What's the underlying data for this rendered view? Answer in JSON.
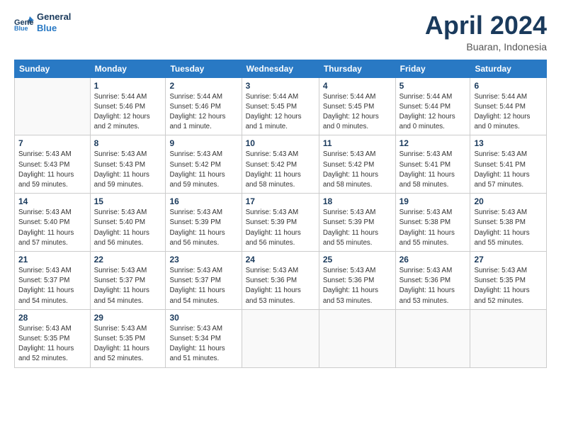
{
  "header": {
    "logo_line1": "General",
    "logo_line2": "Blue",
    "month_title": "April 2024",
    "subtitle": "Buaran, Indonesia"
  },
  "calendar": {
    "headers": [
      "Sunday",
      "Monday",
      "Tuesday",
      "Wednesday",
      "Thursday",
      "Friday",
      "Saturday"
    ],
    "rows": [
      [
        {
          "day": "",
          "info": ""
        },
        {
          "day": "1",
          "info": "Sunrise: 5:44 AM\nSunset: 5:46 PM\nDaylight: 12 hours\nand 2 minutes."
        },
        {
          "day": "2",
          "info": "Sunrise: 5:44 AM\nSunset: 5:46 PM\nDaylight: 12 hours\nand 1 minute."
        },
        {
          "day": "3",
          "info": "Sunrise: 5:44 AM\nSunset: 5:45 PM\nDaylight: 12 hours\nand 1 minute."
        },
        {
          "day": "4",
          "info": "Sunrise: 5:44 AM\nSunset: 5:45 PM\nDaylight: 12 hours\nand 0 minutes."
        },
        {
          "day": "5",
          "info": "Sunrise: 5:44 AM\nSunset: 5:44 PM\nDaylight: 12 hours\nand 0 minutes."
        },
        {
          "day": "6",
          "info": "Sunrise: 5:44 AM\nSunset: 5:44 PM\nDaylight: 12 hours\nand 0 minutes."
        }
      ],
      [
        {
          "day": "7",
          "info": "Sunrise: 5:43 AM\nSunset: 5:43 PM\nDaylight: 11 hours\nand 59 minutes."
        },
        {
          "day": "8",
          "info": "Sunrise: 5:43 AM\nSunset: 5:43 PM\nDaylight: 11 hours\nand 59 minutes."
        },
        {
          "day": "9",
          "info": "Sunrise: 5:43 AM\nSunset: 5:42 PM\nDaylight: 11 hours\nand 59 minutes."
        },
        {
          "day": "10",
          "info": "Sunrise: 5:43 AM\nSunset: 5:42 PM\nDaylight: 11 hours\nand 58 minutes."
        },
        {
          "day": "11",
          "info": "Sunrise: 5:43 AM\nSunset: 5:42 PM\nDaylight: 11 hours\nand 58 minutes."
        },
        {
          "day": "12",
          "info": "Sunrise: 5:43 AM\nSunset: 5:41 PM\nDaylight: 11 hours\nand 58 minutes."
        },
        {
          "day": "13",
          "info": "Sunrise: 5:43 AM\nSunset: 5:41 PM\nDaylight: 11 hours\nand 57 minutes."
        }
      ],
      [
        {
          "day": "14",
          "info": "Sunrise: 5:43 AM\nSunset: 5:40 PM\nDaylight: 11 hours\nand 57 minutes."
        },
        {
          "day": "15",
          "info": "Sunrise: 5:43 AM\nSunset: 5:40 PM\nDaylight: 11 hours\nand 56 minutes."
        },
        {
          "day": "16",
          "info": "Sunrise: 5:43 AM\nSunset: 5:39 PM\nDaylight: 11 hours\nand 56 minutes."
        },
        {
          "day": "17",
          "info": "Sunrise: 5:43 AM\nSunset: 5:39 PM\nDaylight: 11 hours\nand 56 minutes."
        },
        {
          "day": "18",
          "info": "Sunrise: 5:43 AM\nSunset: 5:39 PM\nDaylight: 11 hours\nand 55 minutes."
        },
        {
          "day": "19",
          "info": "Sunrise: 5:43 AM\nSunset: 5:38 PM\nDaylight: 11 hours\nand 55 minutes."
        },
        {
          "day": "20",
          "info": "Sunrise: 5:43 AM\nSunset: 5:38 PM\nDaylight: 11 hours\nand 55 minutes."
        }
      ],
      [
        {
          "day": "21",
          "info": "Sunrise: 5:43 AM\nSunset: 5:37 PM\nDaylight: 11 hours\nand 54 minutes."
        },
        {
          "day": "22",
          "info": "Sunrise: 5:43 AM\nSunset: 5:37 PM\nDaylight: 11 hours\nand 54 minutes."
        },
        {
          "day": "23",
          "info": "Sunrise: 5:43 AM\nSunset: 5:37 PM\nDaylight: 11 hours\nand 54 minutes."
        },
        {
          "day": "24",
          "info": "Sunrise: 5:43 AM\nSunset: 5:36 PM\nDaylight: 11 hours\nand 53 minutes."
        },
        {
          "day": "25",
          "info": "Sunrise: 5:43 AM\nSunset: 5:36 PM\nDaylight: 11 hours\nand 53 minutes."
        },
        {
          "day": "26",
          "info": "Sunrise: 5:43 AM\nSunset: 5:36 PM\nDaylight: 11 hours\nand 53 minutes."
        },
        {
          "day": "27",
          "info": "Sunrise: 5:43 AM\nSunset: 5:35 PM\nDaylight: 11 hours\nand 52 minutes."
        }
      ],
      [
        {
          "day": "28",
          "info": "Sunrise: 5:43 AM\nSunset: 5:35 PM\nDaylight: 11 hours\nand 52 minutes."
        },
        {
          "day": "29",
          "info": "Sunrise: 5:43 AM\nSunset: 5:35 PM\nDaylight: 11 hours\nand 52 minutes."
        },
        {
          "day": "30",
          "info": "Sunrise: 5:43 AM\nSunset: 5:34 PM\nDaylight: 11 hours\nand 51 minutes."
        },
        {
          "day": "",
          "info": ""
        },
        {
          "day": "",
          "info": ""
        },
        {
          "day": "",
          "info": ""
        },
        {
          "day": "",
          "info": ""
        }
      ]
    ]
  }
}
